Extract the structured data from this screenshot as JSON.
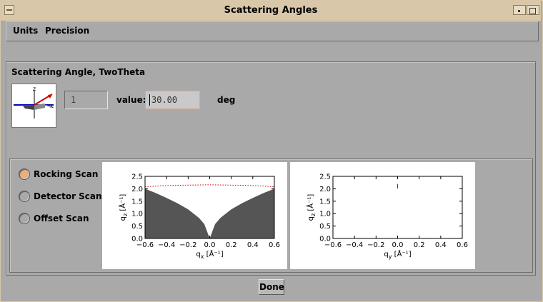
{
  "window": {
    "title": "Scattering Angles"
  },
  "menu": {
    "items": [
      "Units",
      "Precision"
    ]
  },
  "section": {
    "title": "Scattering Angle, TwoTheta"
  },
  "angle": {
    "index": "1",
    "value_label": "value:",
    "value": "30.00",
    "unit": "deg"
  },
  "scan_modes": [
    {
      "label": "Rocking Scan",
      "selected": true
    },
    {
      "label": "Detector Scan",
      "selected": false
    },
    {
      "label": "Offset Scan",
      "selected": false
    }
  ],
  "buttons": {
    "done": "Done"
  },
  "colors": {
    "title_bar": "#d8c7a8",
    "selected_radio": "#e8b078",
    "trace": "#cc0000",
    "shadow_region": "#555555"
  },
  "chart_data": [
    {
      "type": "area",
      "xlabel": "q_x [Å⁻¹]",
      "ylabel": "q_z [Å⁻¹]",
      "xlim": [
        -0.6,
        0.6
      ],
      "ylim": [
        0,
        2.5
      ],
      "xticks": [
        "−0.6",
        "−0.4",
        "−0.2",
        "0.0",
        "0.2",
        "0.4",
        "0.6"
      ],
      "yticks": [
        "0.0",
        "0.5",
        "1.0",
        "1.5",
        "2.0",
        "2.5"
      ],
      "shaded_boundary": {
        "x": [
          -0.6,
          -0.5,
          -0.4,
          -0.3,
          -0.2,
          -0.1,
          -0.05,
          0.0,
          0.05,
          0.1,
          0.2,
          0.3,
          0.4,
          0.5,
          0.6
        ],
        "y": [
          2.0,
          1.83,
          1.63,
          1.42,
          1.17,
          0.83,
          0.58,
          0.0,
          0.58,
          0.83,
          1.17,
          1.42,
          1.63,
          1.83,
          2.0
        ]
      },
      "trace": {
        "x": [
          -0.6,
          -0.45,
          -0.3,
          -0.15,
          0.0,
          0.15,
          0.3,
          0.45,
          0.6
        ],
        "y": [
          2.08,
          2.12,
          2.14,
          2.15,
          2.16,
          2.15,
          2.14,
          2.12,
          2.08
        ]
      }
    },
    {
      "type": "scatter",
      "xlabel": "q_y [Å⁻¹]",
      "ylabel": "q_z [Å⁻¹]",
      "xlim": [
        -0.6,
        0.6
      ],
      "ylim": [
        0,
        2.5
      ],
      "xticks": [
        "−0.6",
        "−0.4",
        "−0.2",
        "0.0",
        "0.2",
        "0.4",
        "0.6"
      ],
      "yticks": [
        "0.0",
        "0.5",
        "1.0",
        "1.5",
        "2.0",
        "2.5"
      ],
      "points": {
        "x": [
          0.0
        ],
        "y": [
          2.1
        ]
      }
    }
  ]
}
